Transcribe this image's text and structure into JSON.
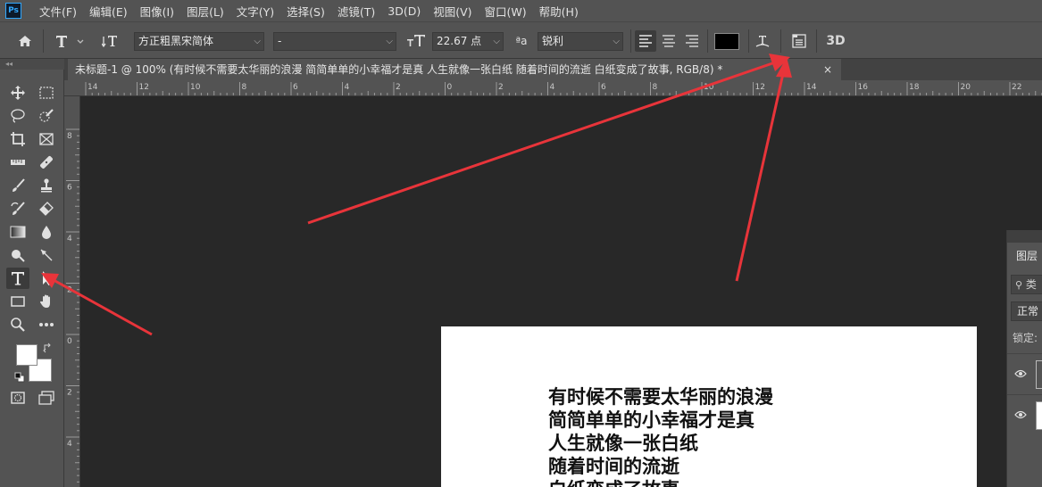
{
  "app": {
    "logo": "Ps"
  },
  "menu": [
    {
      "label": "文件(F)"
    },
    {
      "label": "编辑(E)"
    },
    {
      "label": "图像(I)"
    },
    {
      "label": "图层(L)"
    },
    {
      "label": "文字(Y)"
    },
    {
      "label": "选择(S)"
    },
    {
      "label": "滤镜(T)"
    },
    {
      "label": "3D(D)"
    },
    {
      "label": "视图(V)"
    },
    {
      "label": "窗口(W)"
    },
    {
      "label": "帮助(H)"
    }
  ],
  "options_bar": {
    "font_family": "方正粗黑宋简体",
    "font_style": "-",
    "font_size": "22.67 点",
    "antialias": "锐利",
    "text_color": "#000000",
    "threed_label": "3D"
  },
  "document_tab": {
    "title": "未标题-1 @ 100% (有时候不需要太华丽的浪漫 简简单单的小幸福才是真 人生就像一张白纸 随着时间的流逝 白纸变成了故事, RGB/8) *",
    "close": "×"
  },
  "ruler_top": [
    "14",
    "12",
    "10",
    "8",
    "6",
    "4",
    "2",
    "0",
    "2",
    "4",
    "6",
    "8",
    "10",
    "12",
    "14",
    "16",
    "18",
    "20",
    "22"
  ],
  "ruler_left": [
    "8",
    "6",
    "4",
    "2",
    "0",
    "2",
    "4"
  ],
  "canvas_text": [
    "有时候不需要太华丽的浪漫",
    "简简单单的小幸福才是真",
    "人生就像一张白纸",
    "随着时间的流逝",
    "白纸变成了故事"
  ],
  "layers_panel": {
    "title": "图层",
    "search": "类",
    "blend_mode": "正常",
    "lock_label": "锁定:"
  },
  "colors": {
    "foreground": "#ffffff",
    "background": "#ffffff",
    "annotation_arrow": "#e8343a"
  }
}
